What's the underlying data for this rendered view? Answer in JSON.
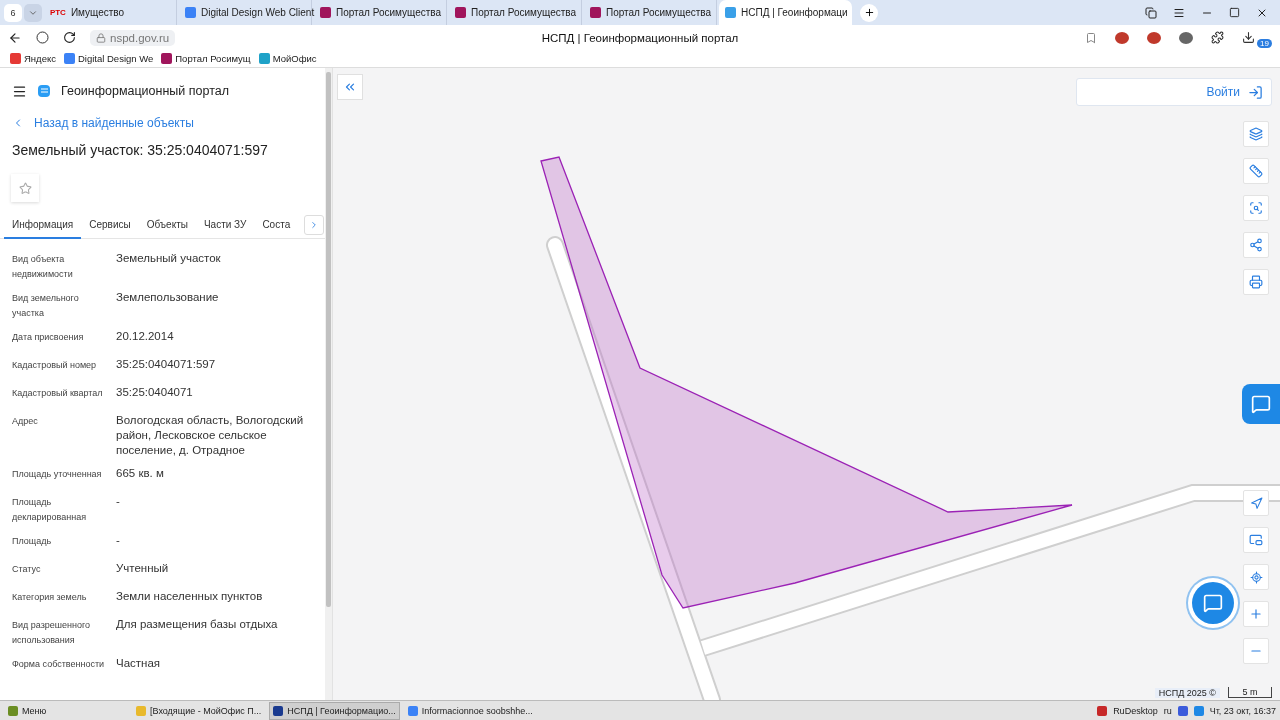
{
  "browser": {
    "tab_count": "6",
    "tabs": [
      {
        "title": "Имущество",
        "badge": "РТС",
        "selected": false
      },
      {
        "title": "Digital Design Web Client",
        "selected": false
      },
      {
        "title": "Портал Росимущества",
        "selected": false
      },
      {
        "title": "Портал Росимущества",
        "selected": false
      },
      {
        "title": "Портал Росимущества",
        "selected": false
      },
      {
        "title": "НСПД | Геоинформаци",
        "selected": true
      }
    ],
    "address": "nspd.gov.ru",
    "page_title": "НСПД | Геоинформационный портал",
    "downloads_badge": "19",
    "bookmarks": [
      "Яндекс",
      "Digital Design We",
      "Портал Росимущ",
      "МойОфис"
    ]
  },
  "panel": {
    "app_title": "Геоинформационный портал",
    "back_link": "Назад в найденные объекты",
    "heading": "Земельный участок: 35:25:0404071:597",
    "favorite": false,
    "tabs": [
      {
        "label": "Информация",
        "selected": true
      },
      {
        "label": "Сервисы",
        "selected": false
      },
      {
        "label": "Объекты",
        "selected": false
      },
      {
        "label": "Части ЗУ",
        "selected": false
      },
      {
        "label": "Соста",
        "selected": false
      }
    ],
    "fields": [
      {
        "label": "Вид объекта недвижимости",
        "value": "Земельный участок"
      },
      {
        "label": "Вид земельного участка",
        "value": "Землепользование"
      },
      {
        "label": "Дата присвоения",
        "value": "20.12.2014"
      },
      {
        "label": "Кадастровый номер",
        "value": "35:25:0404071:597"
      },
      {
        "label": "Кадастровый квартал",
        "value": "35:25:0404071"
      },
      {
        "label": "Адрес",
        "value": "Вологодская область, Вологодский район, Лесковское сельское поселение, д. Отрадное"
      },
      {
        "label": "Площадь уточненная",
        "value": "665 кв. м"
      },
      {
        "label": "Площадь декларированная",
        "value": "-"
      },
      {
        "label": "Площадь",
        "value": "-"
      },
      {
        "label": "Статус",
        "value": "Учтенный"
      },
      {
        "label": "Категория земель",
        "value": "Земли населенных пунктов"
      },
      {
        "label": "Вид разрешенного использования",
        "value": "Для размещения базы отдыха"
      },
      {
        "label": "Форма собственности",
        "value": "Частная"
      }
    ]
  },
  "map": {
    "login": "Войти",
    "attribution": "НСПД 2025 ©",
    "scale": "5 m"
  },
  "taskbar": {
    "menu": "Меню",
    "windows": [
      {
        "title": "[Входящие - МойОфис П...",
        "selected": false
      },
      {
        "title": "НСПД | Геоинформацио...",
        "selected": true
      },
      {
        "title": "Informacionnoe soobshhe...",
        "selected": false
      }
    ],
    "tray_app": "RuDesktop",
    "lang": "ru",
    "clock": "Чт, 23 окт, 16:37"
  }
}
